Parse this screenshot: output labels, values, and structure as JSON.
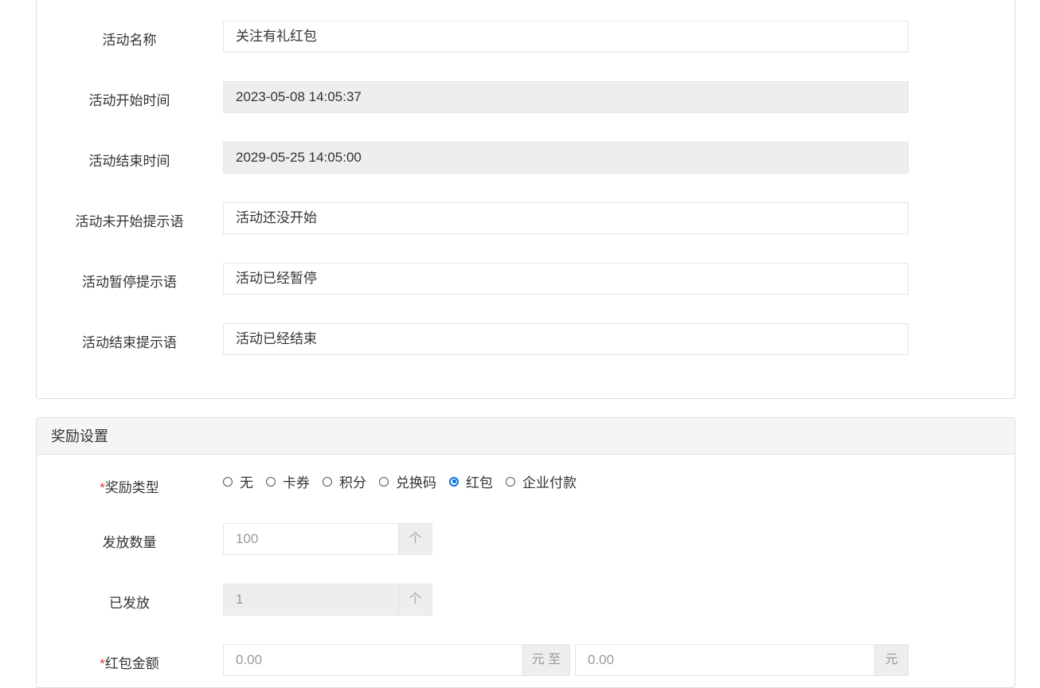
{
  "basic": {
    "fields": [
      {
        "label": "活动名称",
        "value": "关注有礼红包",
        "disabled": false
      },
      {
        "label": "活动开始时间",
        "value": "2023-05-08 14:05:37",
        "disabled": true
      },
      {
        "label": "活动结束时间",
        "value": "2029-05-25 14:05:00",
        "disabled": true
      },
      {
        "label": "活动未开始提示语",
        "value": "活动还没开始",
        "disabled": false
      },
      {
        "label": "活动暂停提示语",
        "value": "活动已经暂停",
        "disabled": false
      },
      {
        "label": "活动结束提示语",
        "value": "活动已经结束",
        "disabled": false
      }
    ]
  },
  "reward": {
    "title": "奖励设置",
    "type_label": "奖励类型",
    "required_mark": "*",
    "type_options": [
      "无",
      "卡券",
      "积分",
      "兑换码",
      "红包",
      "企业付款"
    ],
    "selected_type": "红包",
    "quantity_label": "发放数量",
    "quantity_value": "100",
    "quantity_unit": "个",
    "issued_label": "已发放",
    "issued_value": "1",
    "issued_unit": "个",
    "amount_label": "红包金额",
    "amount_min": "0.00",
    "amount_min_unit": "元 至",
    "amount_max": "0.00",
    "amount_max_unit": "元"
  }
}
